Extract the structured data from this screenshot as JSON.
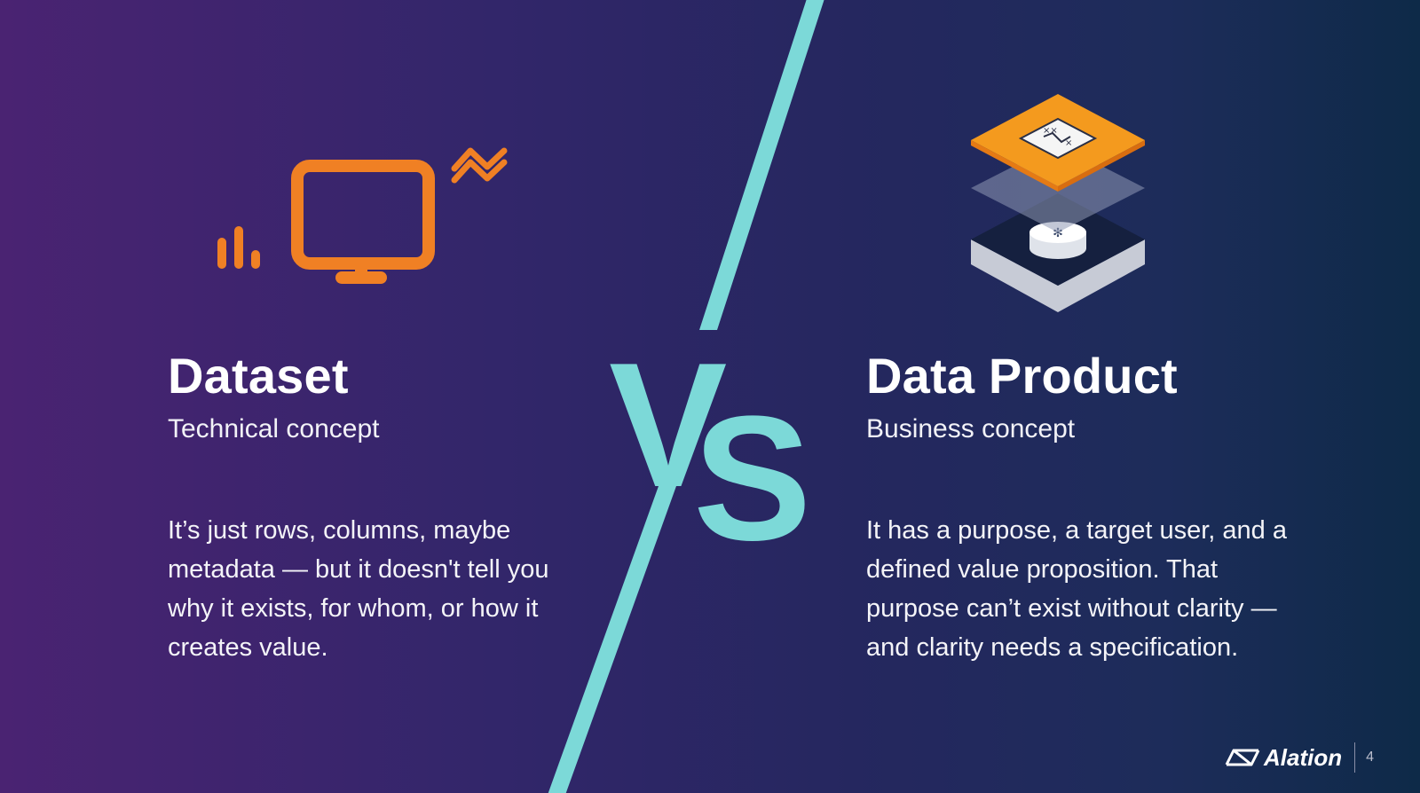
{
  "left": {
    "title": "Dataset",
    "subtitle": "Technical concept",
    "body": "It’s just rows, columns, maybe metadata — but it doesn't tell you why it exists, for whom, or how it creates value.",
    "icon": "monitor-analytics-icon"
  },
  "right": {
    "title": "Data Product",
    "subtitle": "Business concept",
    "body": "It has a purpose, a target user, and a defined value proposition. That purpose can’t exist without clarity — and clarity needs a specification.",
    "icon": "layered-data-product-icon"
  },
  "vs": {
    "v": "V",
    "s": "S"
  },
  "footer": {
    "brand": "Alation",
    "page_number": "4"
  },
  "colors": {
    "accent_teal": "#7cd9d8",
    "accent_orange": "#f08024",
    "bg_left": "#4a2372",
    "bg_right": "#0e2a48"
  }
}
